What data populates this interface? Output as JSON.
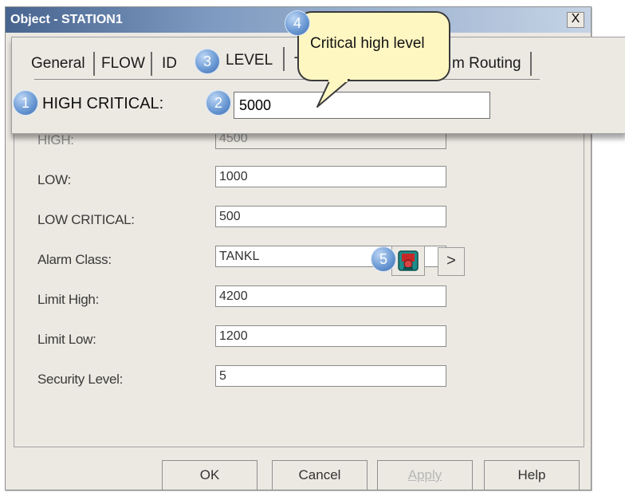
{
  "dialog": {
    "title": "Object - STATION1",
    "close_glyph": "X"
  },
  "fields": [
    {
      "label": "HIGH:",
      "value": "4500",
      "disabled": true
    },
    {
      "label": "LOW:",
      "value": "1000"
    },
    {
      "label": "LOW CRITICAL:",
      "value": "500"
    },
    {
      "label": "Alarm Class:",
      "value": "TANKL"
    },
    {
      "label": "Limit High:",
      "value": "4200"
    },
    {
      "label": "Limit Low:",
      "value": "1200"
    },
    {
      "label": "Security Level:",
      "value": "5"
    }
  ],
  "alarm_class": {
    "icon": "alarm-class-picker-icon",
    "arrow_glyph": ">"
  },
  "buttons": {
    "ok": "OK",
    "cancel": "Cancel",
    "apply": "Apply",
    "help": "Help"
  },
  "zoom": {
    "tabs": [
      {
        "label": "General"
      },
      {
        "label": "FLOW"
      },
      {
        "label": "ID"
      },
      {
        "label": "LEVEL"
      },
      {
        "label": "T"
      },
      {
        "label": "m Routing"
      }
    ],
    "high_critical_label": "HIGH CRITICAL:",
    "high_critical_value": "5000"
  },
  "tooltip": {
    "text": "Critical high level"
  },
  "badges": [
    "1",
    "2",
    "3",
    "4",
    "5"
  ],
  "colors": {
    "titlebar_start": "#47648f",
    "tooltip_bg": "#fff7c2",
    "badge": "#6c9ad4"
  }
}
